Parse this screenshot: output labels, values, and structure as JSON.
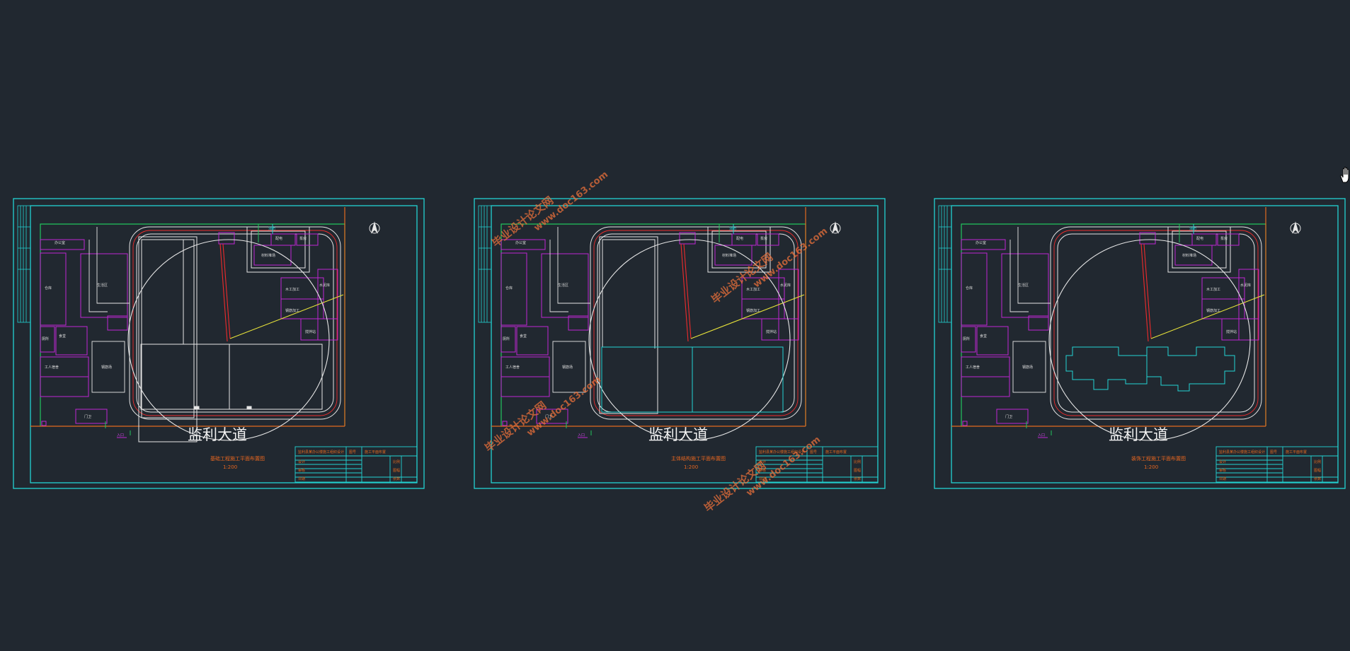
{
  "sheets": [
    {
      "title": "基础工程施工平面布置图",
      "scale": "1:200",
      "road": "监利大道"
    },
    {
      "title": "主体结构施工平面布置图",
      "scale": "1:200",
      "road": "监利大道"
    },
    {
      "title": "装饰工程施工平面布置图",
      "scale": "1:200",
      "road": "监利大道"
    }
  ],
  "watermarks": [
    {
      "text": "毕业设计论文网",
      "url": "www.doc163.com"
    },
    {
      "text": "毕业设计论文网",
      "url": "www.doc163.com"
    },
    {
      "text": "毕业设计论文网",
      "url": "www.doc163.com"
    },
    {
      "text": "毕业设计论文网",
      "url": "www.doc163.com"
    }
  ],
  "colors": {
    "background": "#212830",
    "frame": "#22d3d3",
    "buildings": "#c026d3",
    "roads": "#e6e6e6",
    "fence": "#22c55e",
    "crane_boom": "#ef2b2b",
    "boundary": "#e26a1f",
    "watermark": "#f0723a"
  },
  "icons": {
    "cursor": "hand-cursor-icon",
    "north_arrow": "north-arrow-icon"
  }
}
